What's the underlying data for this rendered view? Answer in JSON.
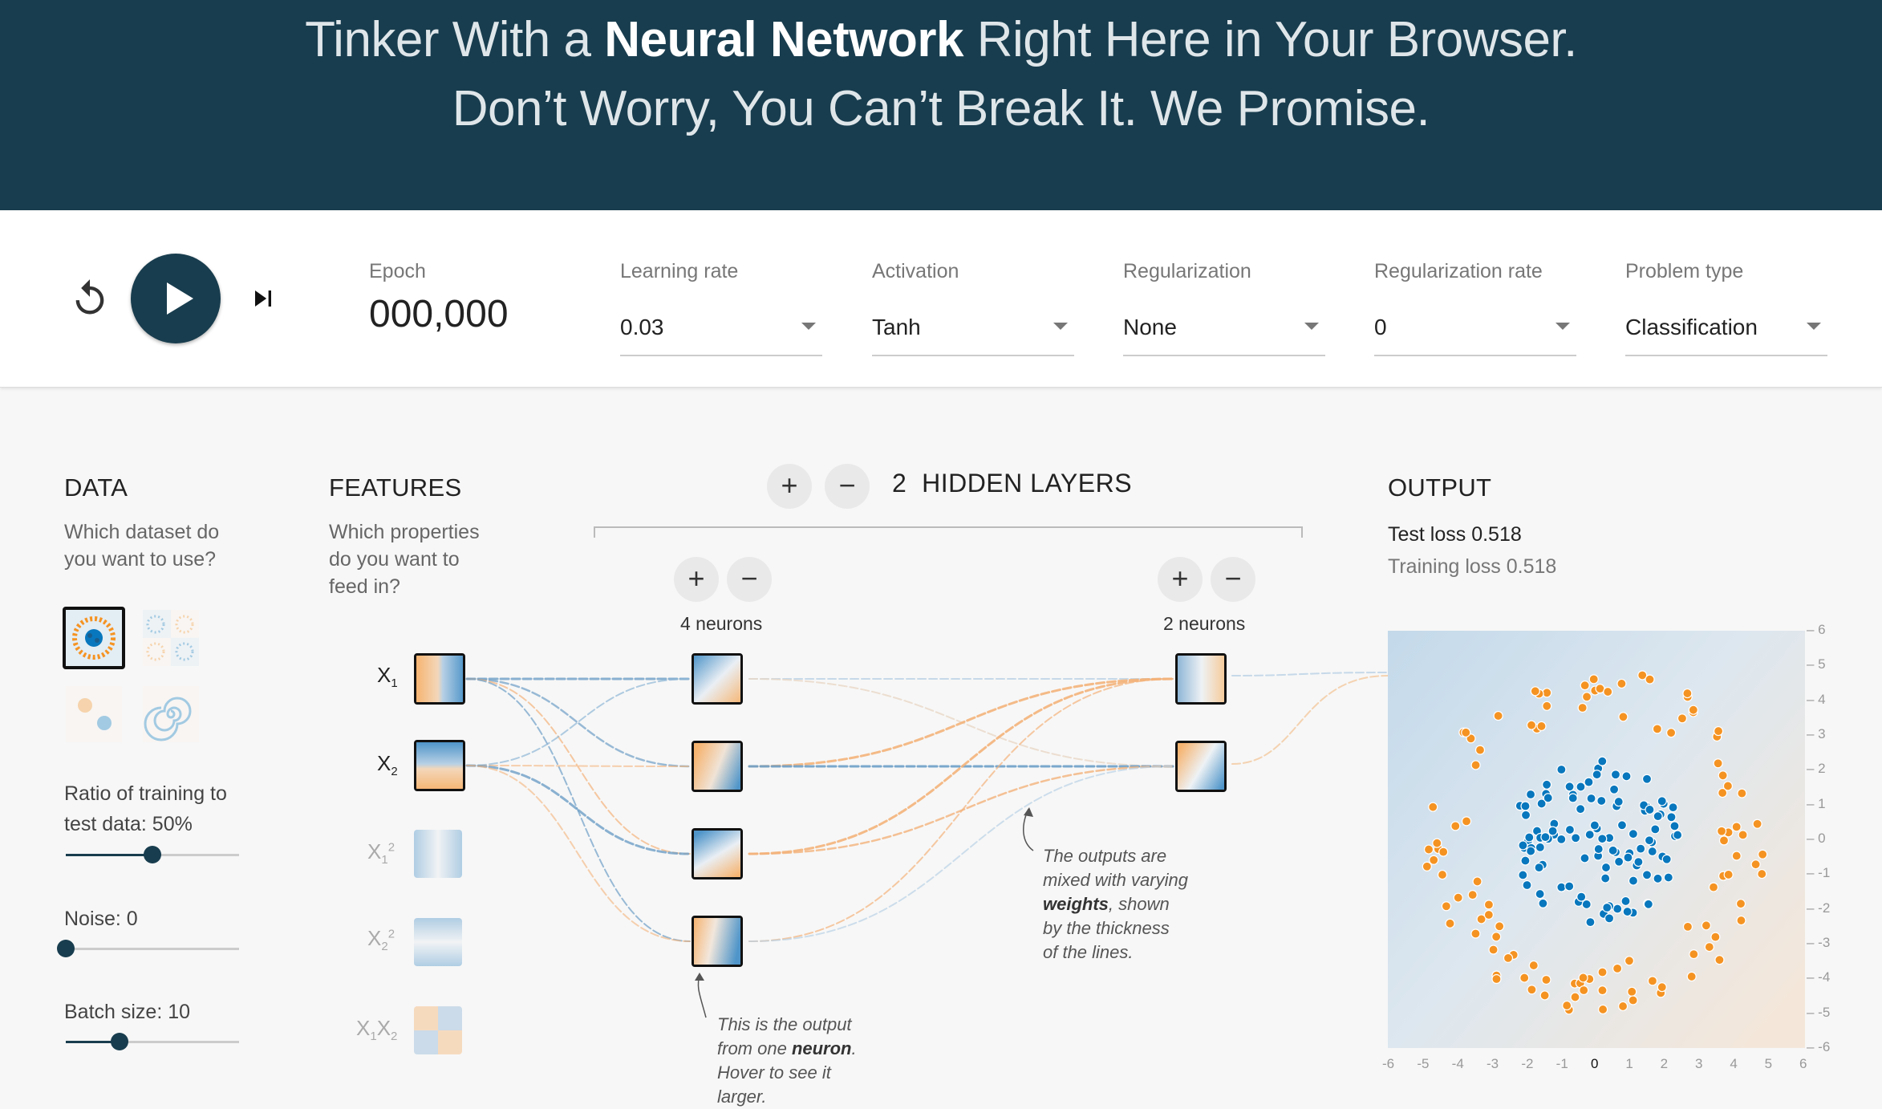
{
  "header": {
    "line1_a": "Tinker With a ",
    "line1_b": "Neural Network",
    "line1_c": " Right Here in Your Browser.",
    "line2": "Don’t Worry, You Can’t Break It. We Promise.",
    "bg_color": "#183d4e"
  },
  "controls": {
    "reset_icon": "reset-icon",
    "play_icon": "play-icon",
    "step_icon": "step-forward-icon",
    "epoch_label": "Epoch",
    "epoch_value": "000,000",
    "learning_rate": {
      "label": "Learning rate",
      "value": "0.03"
    },
    "activation": {
      "label": "Activation",
      "value": "Tanh"
    },
    "regularization": {
      "label": "Regularization",
      "value": "None"
    },
    "regularization_rate": {
      "label": "Regularization rate",
      "value": "0"
    },
    "problem_type": {
      "label": "Problem type",
      "value": "Classification"
    }
  },
  "data_panel": {
    "title": "DATA",
    "question": [
      "Which dataset do",
      "you want to use?"
    ],
    "datasets": [
      "circle",
      "exclusive-or",
      "gaussian",
      "spiral"
    ],
    "selected_dataset": "circle",
    "ratio_label": [
      "Ratio of training to",
      "test data:  50%"
    ],
    "ratio_value": 50,
    "noise_label": "Noise:  0",
    "noise_value": 0,
    "batch_label": "Batch size:  10",
    "batch_value": 10
  },
  "features_panel": {
    "title": "FEATURES",
    "question": [
      "Which properties",
      "do you want to",
      "feed in?"
    ],
    "features": [
      {
        "base": "X",
        "sub": "1",
        "sup": "",
        "active": true
      },
      {
        "base": "X",
        "sub": "2",
        "sup": "",
        "active": true
      },
      {
        "base": "X",
        "sub": "1",
        "sup": "2",
        "active": false
      },
      {
        "base": "X",
        "sub": "2",
        "sup": "2",
        "active": false
      },
      {
        "base": "X",
        "sub": "1",
        "sup": "",
        "base2": "X",
        "sub2": "2",
        "active": false
      }
    ]
  },
  "network": {
    "add_icon": "+",
    "remove_icon": "−",
    "hidden_layers_count": "2",
    "hidden_layers_label": "HIDDEN LAYERS",
    "layer1_neurons": "4 neurons",
    "layer2_neurons": "2 neurons",
    "annotation_neuron": [
      "This is the output",
      "from one ",
      "neuron",
      ".",
      "Hover to see it",
      "larger."
    ],
    "annotation_weights": [
      "The outputs are",
      "mixed with varying",
      "weights",
      ", shown",
      "by the thickness",
      "of the lines."
    ]
  },
  "output_panel": {
    "title": "OUTPUT",
    "test_loss": "Test loss 0.518",
    "training_loss": "Training loss 0.518",
    "x_ticks": [
      "-6",
      "-5",
      "-4",
      "-3",
      "-2",
      "-1",
      "0",
      "1",
      "2",
      "3",
      "4",
      "5",
      "6"
    ],
    "y_ticks": [
      "6",
      "5",
      "4",
      "3",
      "2",
      "1",
      "0",
      "-1",
      "-2",
      "-3",
      "-4",
      "-5",
      "-6"
    ],
    "colors": {
      "positive": "#f59322",
      "negative": "#0877bd"
    }
  }
}
